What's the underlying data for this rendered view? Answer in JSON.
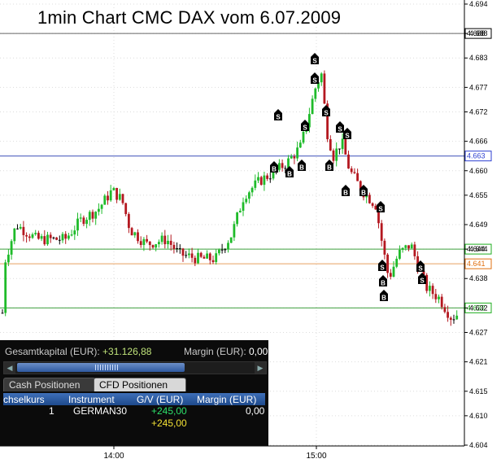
{
  "title": "1min Chart CMC   DAX vom 6.07.2009",
  "price_axis": {
    "labels": [
      "4.694",
      "4.688",
      "4.683",
      "4.677",
      "4.672",
      "4.666",
      "4.660",
      "4.655",
      "4.649",
      "4.644",
      "4.638",
      "4.632",
      "4.627",
      "4.621",
      "4.615",
      "4.610",
      "4.604"
    ],
    "range": [
      4.604,
      4.694
    ]
  },
  "time_axis": {
    "labels": [
      "14:00",
      "15:00"
    ]
  },
  "levels": [
    {
      "value": 4.688,
      "label": "4.688",
      "line_color": "#666666",
      "box_color": "#000000",
      "text_color": "#000000"
    },
    {
      "value": 4.663,
      "label": "4.663",
      "line_color": "#3c4fb8",
      "box_color": "#2c3fd0",
      "text_color": "#2c3fd0"
    },
    {
      "value": 4.644,
      "label": "4.644",
      "line_color": "#3fa03f",
      "box_color": "#1fae1f",
      "text_color": "#000000"
    },
    {
      "value": 4.641,
      "label": "4.641",
      "line_color": "#e8a060",
      "box_color": "#e07010",
      "text_color": "#e07010"
    },
    {
      "value": 4.632,
      "label": "4.632",
      "line_color": "#3fa03f",
      "box_color": "#1fae1f",
      "text_color": "#1fae1f"
    }
  ],
  "colors": {
    "up": "#1fbb2a",
    "down": "#b41820",
    "doji": "#000000"
  },
  "panel": {
    "capital_label": "Gesamtkapital (EUR):",
    "capital_value": "+31.126,88",
    "margin_label": "Margin (EUR):",
    "margin_value": "0,00",
    "tabs": [
      "Cash Positionen",
      "CFD Positionen"
    ],
    "headers": [
      "chselkurs",
      "Instrument",
      "G/V (EUR)",
      "Margin (EUR)"
    ],
    "rows": [
      {
        "rate": "1",
        "instrument": "GERMAN30",
        "pl": "+245,00",
        "margin": "0,00"
      },
      {
        "rate": "",
        "instrument": "",
        "pl": "+245,00",
        "margin": ""
      }
    ]
  }
}
